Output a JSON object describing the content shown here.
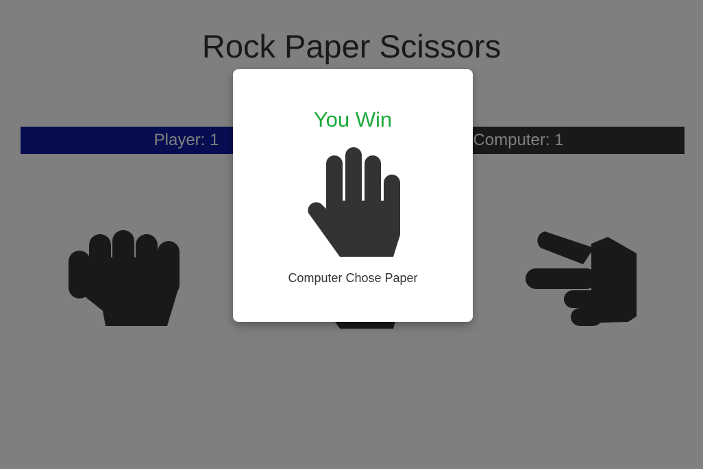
{
  "game": {
    "title": "Rock Paper Scissors"
  },
  "score": {
    "player_label": "Player: 1",
    "computer_label": "Computer: 1"
  },
  "choices": [
    {
      "name": "rock",
      "icon": "rock-hand-icon"
    },
    {
      "name": "paper",
      "icon": "paper-hand-icon"
    },
    {
      "name": "scissors",
      "icon": "scissors-hand-icon"
    }
  ],
  "modal": {
    "result": "You Win",
    "computer_choice_text": "Computer Chose Paper",
    "icon": "paper-hand-icon"
  },
  "colors": {
    "player_bar": "#0d1ba3",
    "computer_bar": "#333333",
    "win_text": "#1aaa3a",
    "overlay": "rgba(0,0,0,0.5)"
  }
}
